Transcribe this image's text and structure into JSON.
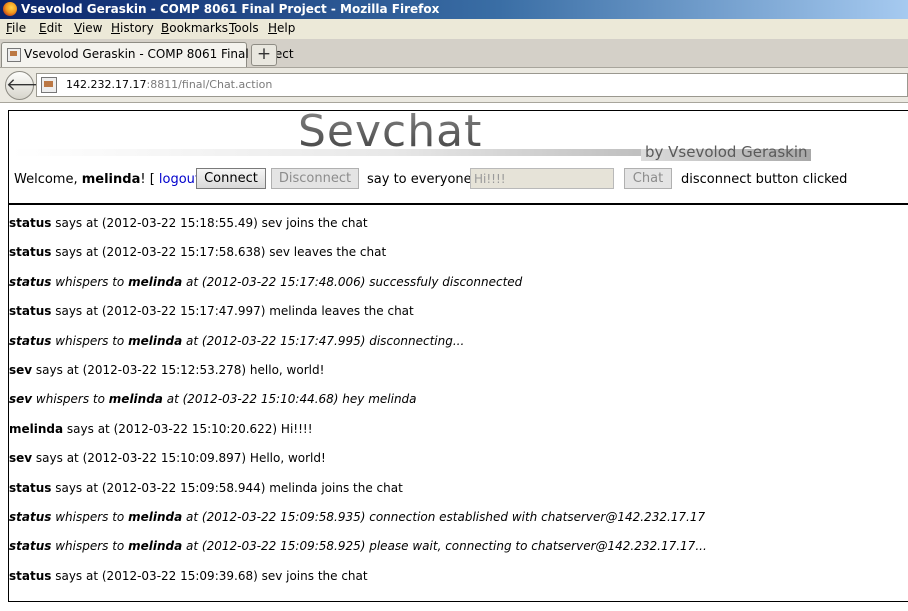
{
  "window": {
    "title": "Vsevolod Geraskin - COMP 8061 Final Project - Mozilla Firefox"
  },
  "menubar": {
    "items": [
      {
        "label": "File",
        "accel": "F",
        "rest": "ile"
      },
      {
        "label": "Edit",
        "accel": "E",
        "rest": "dit"
      },
      {
        "label": "View",
        "accel": "V",
        "rest": "iew"
      },
      {
        "label": "History",
        "accel": "H",
        "rest": "istory"
      },
      {
        "label": "Bookmarks",
        "accel": "B",
        "rest": "ookmarks"
      },
      {
        "label": "Tools",
        "accel": "T",
        "rest": "ools"
      },
      {
        "label": "Help",
        "accel": "H",
        "rest": "elp"
      }
    ]
  },
  "tab": {
    "label": "Vsevolod Geraskin - COMP 8061 Final Project",
    "new_tab_label": "+"
  },
  "navbar": {
    "back_label": "🡐",
    "url_host": "142.232.17.17",
    "url_rest": ":8811/final/Chat.action"
  },
  "header": {
    "logo": "Sevchat",
    "byline": "by Vsevolod Geraskin"
  },
  "controls": {
    "welcome_prefix": "Welcome, ",
    "username": "melinda",
    "welcome_suffix": "! [ ",
    "logout_label": "logout",
    "logout_suffix": " ]",
    "connect_label": "Connect",
    "disconnect_label": "Disconnect",
    "say_label": "say to everyone:",
    "message_value": "Hi!!!!",
    "chat_label": "Chat",
    "status": "disconnect button clicked"
  },
  "messages": [
    {
      "sender": "status",
      "verb": " says at ",
      "to": "",
      "text": "(2012-03-22 15:18:55.49) sev joins the chat",
      "whisper": false
    },
    {
      "sender": "status",
      "verb": " says at ",
      "to": "",
      "text": "(2012-03-22 15:17:58.638) sev leaves the chat",
      "whisper": false
    },
    {
      "sender": "status",
      "verb": " whispers to ",
      "to": "melinda",
      "text": " at (2012-03-22 15:17:48.006) successfuly disconnected",
      "whisper": true
    },
    {
      "sender": "status",
      "verb": " says at ",
      "to": "",
      "text": "(2012-03-22 15:17:47.997) melinda leaves the chat",
      "whisper": false
    },
    {
      "sender": "status",
      "verb": " whispers to ",
      "to": "melinda",
      "text": " at (2012-03-22 15:17:47.995) disconnecting...",
      "whisper": true
    },
    {
      "sender": "sev",
      "verb": " says at ",
      "to": "",
      "text": "(2012-03-22 15:12:53.278) hello, world!",
      "whisper": false
    },
    {
      "sender": "sev",
      "verb": " whispers to ",
      "to": "melinda",
      "text": " at (2012-03-22 15:10:44.68) hey melinda",
      "whisper": true
    },
    {
      "sender": "melinda",
      "verb": " says at ",
      "to": "",
      "text": "(2012-03-22 15:10:20.622) Hi!!!!",
      "whisper": false
    },
    {
      "sender": "sev",
      "verb": " says at ",
      "to": "",
      "text": "(2012-03-22 15:10:09.897) Hello, world!",
      "whisper": false
    },
    {
      "sender": "status",
      "verb": " says at ",
      "to": "",
      "text": "(2012-03-22 15:09:58.944) melinda joins the chat",
      "whisper": false
    },
    {
      "sender": "status",
      "verb": " whispers to ",
      "to": "melinda",
      "text": " at (2012-03-22 15:09:58.935) connection established with chatserver@142.232.17.17",
      "whisper": true
    },
    {
      "sender": "status",
      "verb": " whispers to ",
      "to": "melinda",
      "text": " at (2012-03-22 15:09:58.925) please wait, connecting to chatserver@142.232.17.17...",
      "whisper": true
    },
    {
      "sender": "status",
      "verb": " says at ",
      "to": "",
      "text": "(2012-03-22 15:09:39.68) sev joins the chat",
      "whisper": false
    }
  ]
}
